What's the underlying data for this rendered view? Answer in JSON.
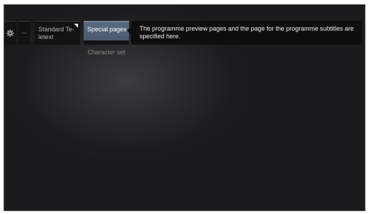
{
  "menu": {
    "more_label": "...",
    "teletext_label": "Standard Te-letext",
    "special_pages_label": "Special pages",
    "character_set_label": "Character set"
  },
  "info": {
    "text": "The programme preview pages and the page for the programme subtitles are specified here."
  },
  "icons": {
    "settings": "gear-icon",
    "teletext_flag": "corner-flag-icon"
  },
  "colors": {
    "selected_tile": "#4f5f76",
    "background": "#1d1d1f"
  }
}
